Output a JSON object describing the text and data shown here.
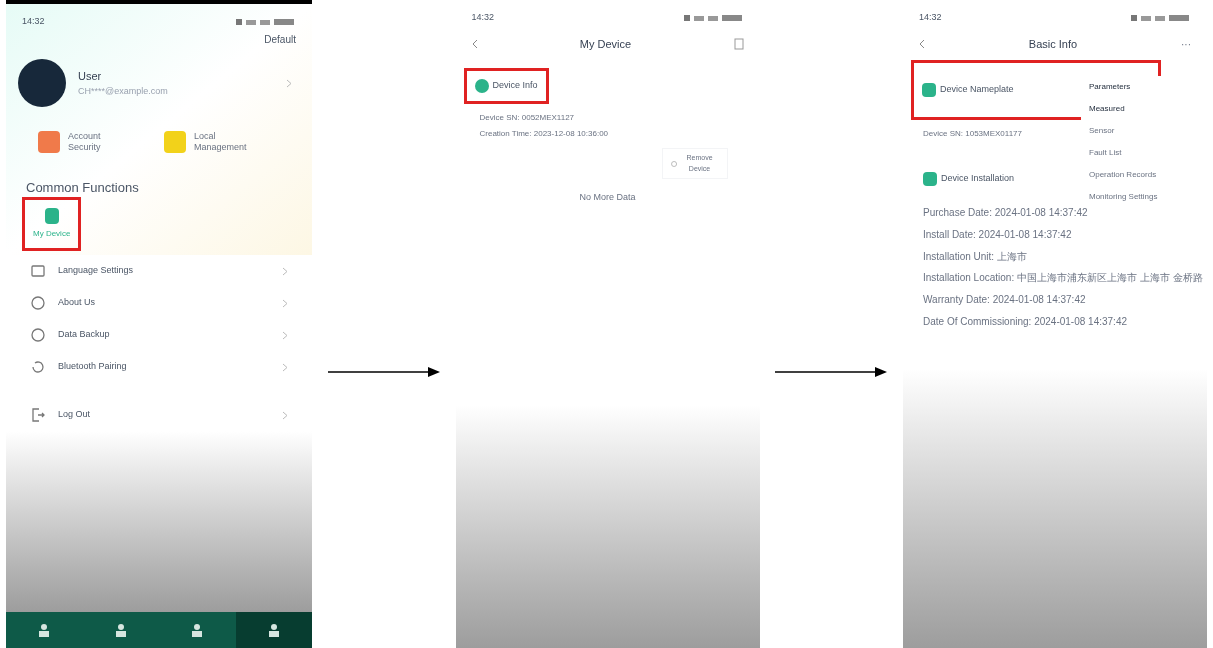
{
  "screens": [
    {
      "kind": "profile",
      "status_time": "14:32",
      "header_action": "Default",
      "user": {
        "name": "User",
        "email": "CH****@example.com"
      },
      "shortcuts": [
        {
          "label": "Account Security",
          "color": "#f07a4a"
        },
        {
          "label": "Local Management",
          "color": "#f2d21a"
        }
      ],
      "section_title": "Common Functions",
      "functions": [
        {
          "label": "My Device",
          "highlighted": true
        }
      ],
      "menu": [
        {
          "label": "Language Settings"
        },
        {
          "label": "About Us"
        },
        {
          "label": "Data Backup"
        },
        {
          "label": "Bluetooth Pairing"
        },
        {
          "label": "Log Out"
        }
      ],
      "tabs": [
        {
          "selected": false
        },
        {
          "selected": false
        },
        {
          "selected": false
        },
        {
          "selected": true
        }
      ]
    },
    {
      "kind": "device_list",
      "status_time": "14:32",
      "title": "My Device",
      "device": {
        "name": "Device Info",
        "highlighted": true,
        "fields": [
          "Device SN: 0052MEX1127",
          "Creation Time: 2023-12-08 10:36:00"
        ],
        "remove_label": "Remove Device"
      },
      "footer": "No More Data"
    },
    {
      "kind": "basic_info",
      "status_time": "14:32",
      "title": "Basic Info",
      "more": "···",
      "nameplate": {
        "label": "Device Nameplate",
        "highlighted": true
      },
      "sn": "Device SN: 1053MEX01177",
      "menu": [
        {
          "label": "Parameters",
          "highlighted": true
        },
        {
          "label": "Measured",
          "highlighted": true
        },
        {
          "label": "Sensor",
          "highlighted": false
        },
        {
          "label": "Fault List",
          "highlighted": false
        },
        {
          "label": "Operation Records",
          "highlighted": false
        },
        {
          "label": "Monitoring Settings",
          "highlighted": false
        }
      ],
      "installation": "Device Installation",
      "fields": [
        "Purchase Date: 2024-01-08 14:37:42",
        "Install Date: 2024-01-08 14:37:42",
        "Installation Unit: 上海市",
        "Installation Location: 中国上海市浦东新区上海市 上海市 金桥路",
        "Warranty Date: 2024-01-08 14:37:42",
        "Date Of Commissioning: 2024-01-08 14:37:42"
      ]
    }
  ]
}
